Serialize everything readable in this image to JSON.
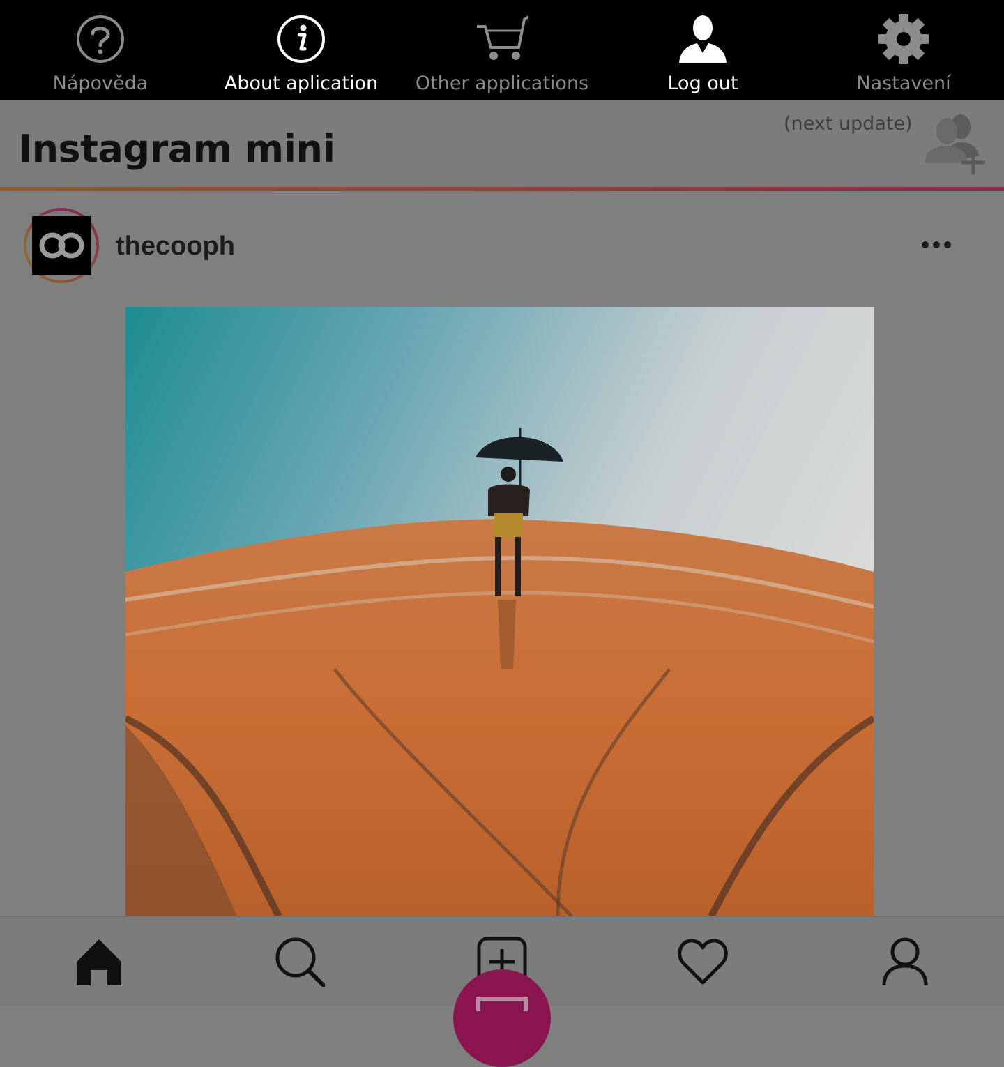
{
  "top_menu": {
    "items": [
      {
        "label": "Nápověda",
        "icon": "help-icon"
      },
      {
        "label": "About aplication",
        "icon": "info-icon"
      },
      {
        "label": "Other applications",
        "icon": "cart-icon"
      },
      {
        "label": "Log out",
        "icon": "user-icon"
      },
      {
        "label": "Nastavení",
        "icon": "gear-icon"
      }
    ]
  },
  "header": {
    "title": "Instagram mini",
    "next_update": "(next update)",
    "add_icon": "add-users-icon"
  },
  "post": {
    "username": "thecooph",
    "more_icon": "more-icon"
  },
  "bottom_nav": {
    "items": [
      "home-icon",
      "search-icon",
      "new-post-icon",
      "heart-icon",
      "profile-icon"
    ]
  },
  "colors": {
    "accent": "#8a1550",
    "menu_bg": "#000000",
    "dim_overlay": "#7f7f7f"
  }
}
